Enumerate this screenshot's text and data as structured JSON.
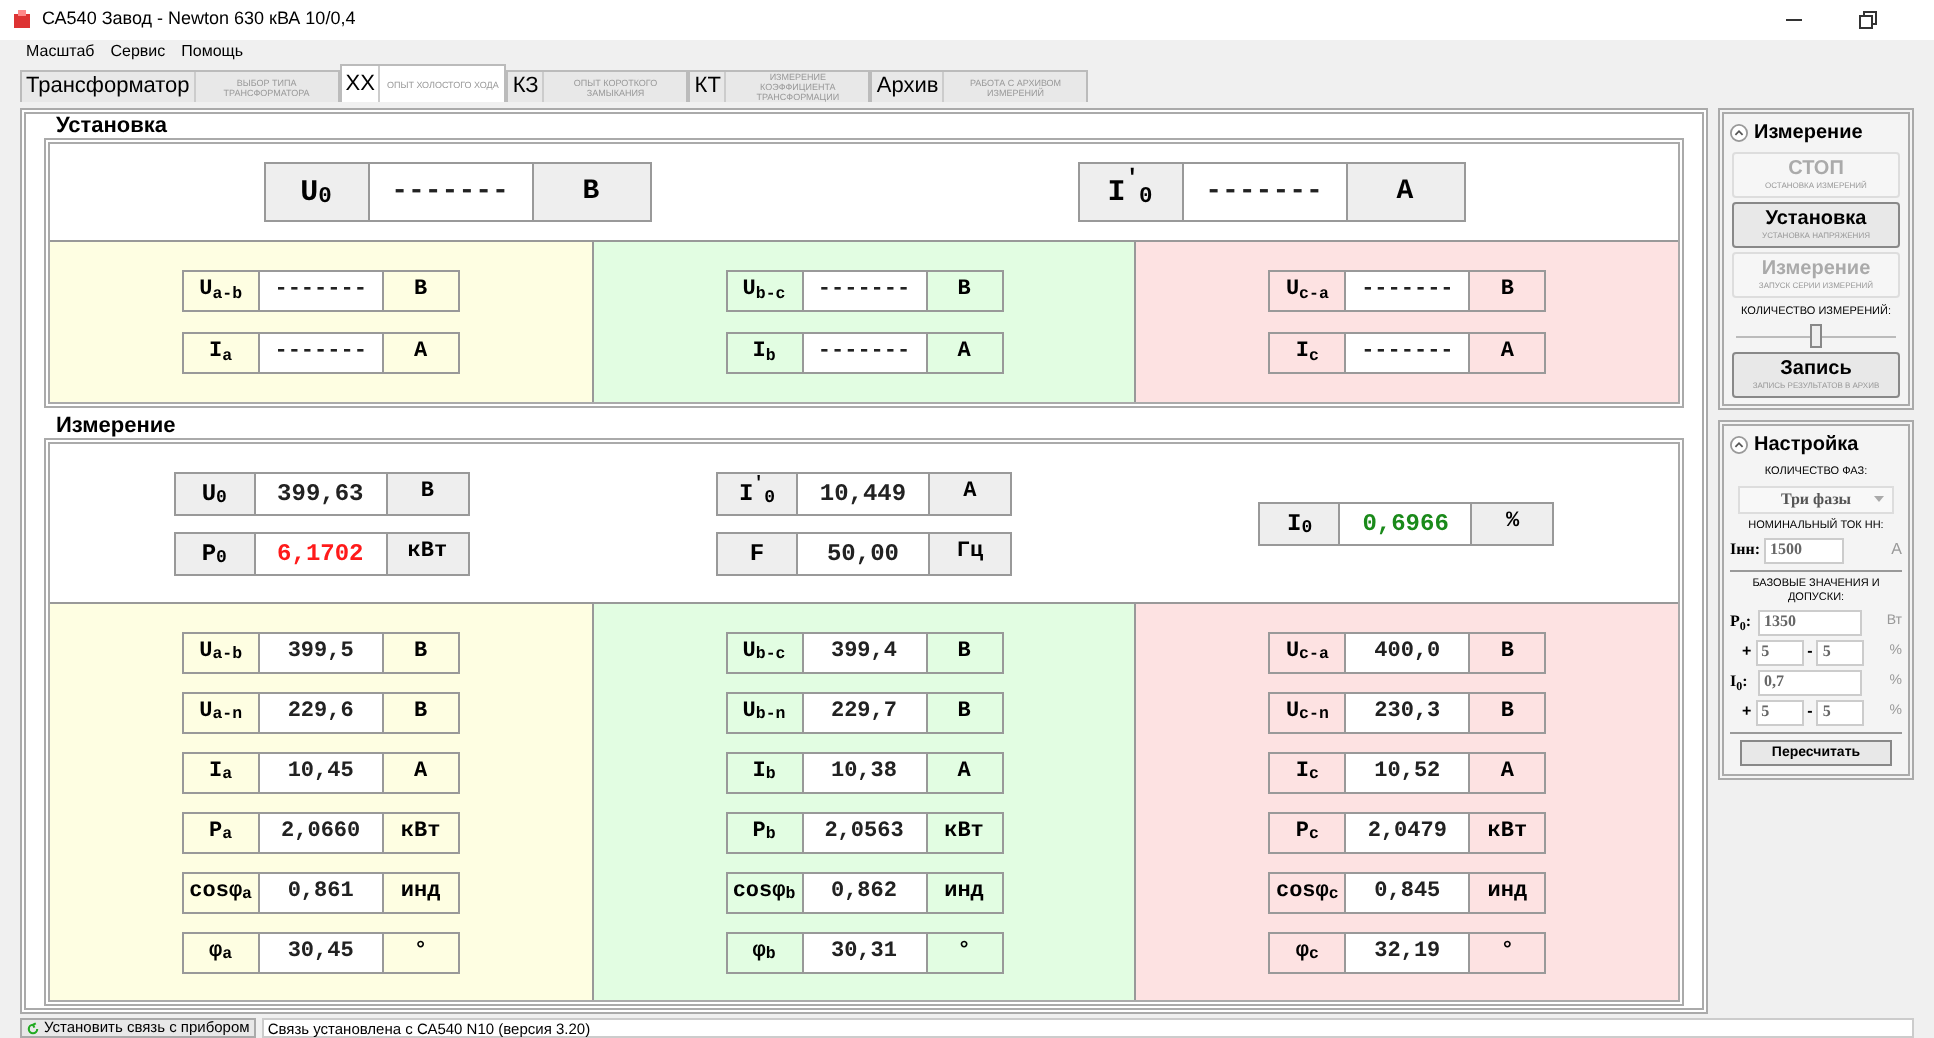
{
  "window": {
    "title": "СА540 Завод - Newton 630 кВА 10/0,4"
  },
  "menu": [
    "Масштаб",
    "Сервис",
    "Помощь"
  ],
  "tabs": [
    {
      "label": "Трансформатор",
      "subtitle": "ВЫБОР ТИПА ТРАНСФОРМАТОРА",
      "selected": false
    },
    {
      "label": "ХХ",
      "subtitle": "ОПЫТ ХОЛОСТОГО ХОДА",
      "selected": true
    },
    {
      "label": "КЗ",
      "subtitle": "ОПЫТ КОРОТКОГО ЗАМЫКАНИЯ",
      "selected": false
    },
    {
      "label": "КТ",
      "subtitle": "ИЗМЕРЕНИЕ КОЭФФИЦИЕНТА ТРАНСФОРМАЦИИ",
      "selected": false
    },
    {
      "label": "Архив",
      "subtitle": "РАБОТА С АРХИВОМ ИЗМЕРЕНИЙ",
      "selected": false
    }
  ],
  "setup": {
    "title": "Установка",
    "totals": [
      [
        {
          "label": "U$_{0}$",
          "value": "-------",
          "unit": "В"
        }
      ],
      [
        {
          "label": "I$^{′}$$_{0}$",
          "value": "-------",
          "unit": "А"
        }
      ]
    ],
    "phases": [
      {
        "color": "#fefee2",
        "readouts": [
          {
            "label": "U$_{a-b}$",
            "value": "-------",
            "unit": "В"
          },
          {
            "label": "I$_{a}$",
            "value": "-------",
            "unit": "А"
          }
        ]
      },
      {
        "color": "#e2fde2",
        "readouts": [
          {
            "label": "U$_{b-c}$",
            "value": "-------",
            "unit": "В"
          },
          {
            "label": "I$_{b}$",
            "value": "-------",
            "unit": "А"
          }
        ]
      },
      {
        "color": "#fde2e2",
        "readouts": [
          {
            "label": "U$_{c-a}$",
            "value": "-------",
            "unit": "В"
          },
          {
            "label": "I$_{c}$",
            "value": "-------",
            "unit": "А"
          }
        ]
      }
    ]
  },
  "measure": {
    "title": "Измерение",
    "totals": [
      [
        {
          "label": "U$_{0}$",
          "value": "399,63",
          "unit": "В"
        },
        {
          "label": "P$_{0}$",
          "value": "6,1702",
          "unit": "кВт",
          "color": "#ff1a1a"
        }
      ],
      [
        {
          "label": "I$^{′}$$_{0}$",
          "value": "10,449",
          "unit": "А"
        },
        {
          "label": "F",
          "value": "50,00",
          "unit": "Гц"
        }
      ],
      [
        {
          "label": "I$_{0}$",
          "value": "0,6966",
          "unit": "%",
          "color": "#1a8a1a"
        }
      ]
    ],
    "phases": [
      {
        "color": "#fefee2",
        "readouts": [
          {
            "label": "U$_{a-b}$",
            "value": "399,5",
            "unit": "В"
          },
          {
            "label": "U$_{a-n}$",
            "value": "229,6",
            "unit": "В"
          },
          {
            "label": "I$_{a}$",
            "value": "10,45",
            "unit": "А"
          },
          {
            "label": "P$_{a}$",
            "value": "2,0660",
            "unit": "кВт"
          },
          {
            "label": "cosφ$_{a}$",
            "value": "0,861",
            "unit": "инд"
          },
          {
            "label": "φ$_{a}$",
            "value": "30,45",
            "unit": "°"
          }
        ]
      },
      {
        "color": "#e2fde2",
        "readouts": [
          {
            "label": "U$_{b-c}$",
            "value": "399,4",
            "unit": "В"
          },
          {
            "label": "U$_{b-n}$",
            "value": "229,7",
            "unit": "В"
          },
          {
            "label": "I$_{b}$",
            "value": "10,38",
            "unit": "А"
          },
          {
            "label": "P$_{b}$",
            "value": "2,0563",
            "unit": "кВт"
          },
          {
            "label": "cosφ$_{b}$",
            "value": "0,862",
            "unit": "инд"
          },
          {
            "label": "φ$_{b}$",
            "value": "30,31",
            "unit": "°"
          }
        ]
      },
      {
        "color": "#fde2e2",
        "readouts": [
          {
            "label": "U$_{c-a}$",
            "value": "400,0",
            "unit": "В"
          },
          {
            "label": "U$_{c-n}$",
            "value": "230,3",
            "unit": "В"
          },
          {
            "label": "I$_{c}$",
            "value": "10,52",
            "unit": "А"
          },
          {
            "label": "P$_{c}$",
            "value": "2,0479",
            "unit": "кВт"
          },
          {
            "label": "cosφ$_{c}$",
            "value": "0,845",
            "unit": "инд"
          },
          {
            "label": "φ$_{c}$",
            "value": "32,19",
            "unit": "°"
          }
        ]
      }
    ]
  },
  "control": {
    "title": "Измерение",
    "expanded": true,
    "buttons": [
      {
        "label": "СТОП",
        "caption": "ОСТАНОВКА ИЗМЕРЕНИЙ",
        "disabled": true
      },
      {
        "label": "Установка",
        "caption": "УСТАНОВКА НАПРЯЖЕНИЯ",
        "disabled": false
      },
      {
        "label": "Измерение",
        "caption": "ЗАПУСК СЕРИИ ИЗМЕРЕНИЙ",
        "disabled": true
      }
    ],
    "count_label": "КОЛИЧЕСТВО ИЗМЕРЕНИЙ:",
    "slider": {
      "level": 0.5
    },
    "record": {
      "label": "Запись",
      "caption": "ЗАПИСЬ РЕЗУЛЬТАТОВ В АРХИВ",
      "disabled": false
    }
  },
  "settings": {
    "title": "Настройка",
    "expanded": true,
    "phases_label": "КОЛИЧЕСТВО ФАЗ:",
    "phases_value": "Три фазы",
    "current_label": "НОМИНАЛЬНЫЙ ТОК НН:",
    "inn_label": "Iнн:",
    "inn_value": "1500",
    "inn_unit": "А",
    "base_label": "БАЗОВЫЕ ЗНАЧЕНИЯ И ДОПУСКИ:",
    "bases": [
      {
        "label": "P$_{0}$:",
        "value": "1350",
        "unit": "Вт",
        "plus": "+",
        "plus_value": "5",
        "minus": "-",
        "minus_value": "5",
        "tol_unit": "%"
      },
      {
        "label": "I$_{0}$:",
        "value": "0,7",
        "unit": "%",
        "plus": "+",
        "plus_value": "5",
        "minus": "-",
        "minus_value": "5",
        "tol_unit": "%"
      }
    ],
    "recalc": "Пересчитать"
  },
  "status": {
    "connect": "Установить связь с прибором",
    "message": "Связь установлена с СА540 N10 (версия 3.20)"
  }
}
